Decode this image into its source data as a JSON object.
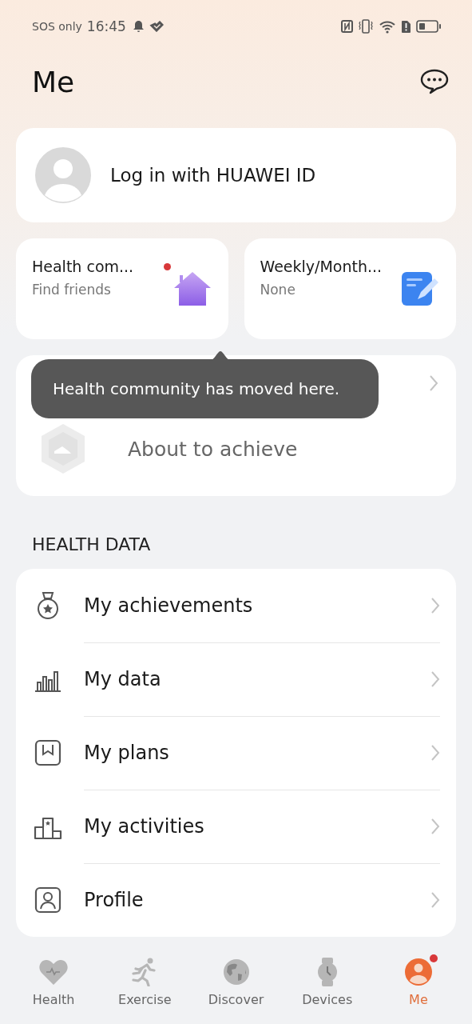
{
  "status_bar": {
    "carrier": "SOS only",
    "time": "16:45"
  },
  "header": {
    "title": "Me"
  },
  "login": {
    "label": "Log in with HUAWEI ID"
  },
  "tiles": [
    {
      "kind": "community",
      "title": "Health com...",
      "subtitle": "Find friends",
      "badge": true
    },
    {
      "kind": "report",
      "title": "Weekly/Month...",
      "subtitle": "None",
      "badge": false
    }
  ],
  "medals": {
    "status": "About to achieve"
  },
  "tooltip": {
    "text": "Health community has moved here."
  },
  "section_title": "HEALTH DATA",
  "health_items": [
    {
      "kind": "achievements",
      "label": "My achievements"
    },
    {
      "kind": "data",
      "label": "My data"
    },
    {
      "kind": "plans",
      "label": "My plans"
    },
    {
      "kind": "activities",
      "label": "My activities"
    },
    {
      "kind": "profile",
      "label": "Profile"
    }
  ],
  "nav": [
    {
      "kind": "health",
      "label": "Health",
      "selected": false,
      "badge": false
    },
    {
      "kind": "exercise",
      "label": "Exercise",
      "selected": false,
      "badge": false
    },
    {
      "kind": "discover",
      "label": "Discover",
      "selected": false,
      "badge": false
    },
    {
      "kind": "devices",
      "label": "Devices",
      "selected": false,
      "badge": false
    },
    {
      "kind": "me",
      "label": "Me",
      "selected": true,
      "badge": true
    }
  ]
}
